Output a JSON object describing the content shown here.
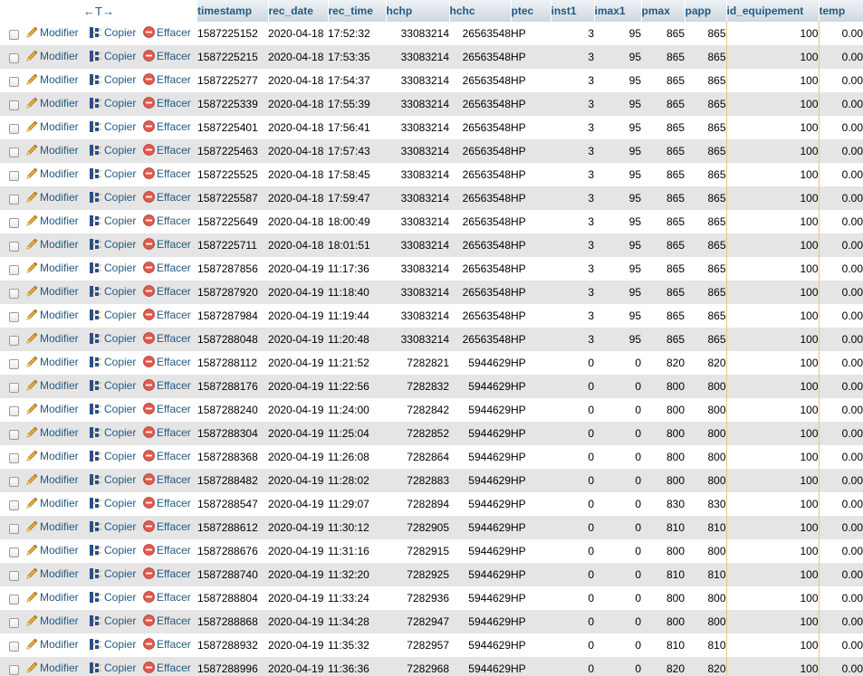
{
  "header": {
    "arrows_label": "←T→",
    "columns": [
      "timestamp",
      "rec_date",
      "rec_time",
      "hchp",
      "hchc",
      "ptec",
      "inst1",
      "imax1",
      "pmax",
      "papp",
      "id_equipement",
      "temp"
    ]
  },
  "actions": {
    "edit_label": "Modifier",
    "copy_label": "Copier",
    "delete_label": "Effacer",
    "edit_icon": "pencil-icon",
    "copy_icon": "copy-icon",
    "delete_icon": "delete-icon"
  },
  "colors": {
    "link": "#235a81",
    "row_alt": "#e5e5e5",
    "delete_icon": "#e05a4f"
  },
  "rows": [
    {
      "timestamp": "1587225152",
      "rec_date": "2020-04-18",
      "rec_time": "17:52:32",
      "hchp": "33083214",
      "hchc": "26563548",
      "ptec": "HP",
      "inst1": "3",
      "imax1": "95",
      "pmax": "865",
      "papp": "865",
      "id_equipement": "100",
      "temp": "0.00"
    },
    {
      "timestamp": "1587225215",
      "rec_date": "2020-04-18",
      "rec_time": "17:53:35",
      "hchp": "33083214",
      "hchc": "26563548",
      "ptec": "HP",
      "inst1": "3",
      "imax1": "95",
      "pmax": "865",
      "papp": "865",
      "id_equipement": "100",
      "temp": "0.00"
    },
    {
      "timestamp": "1587225277",
      "rec_date": "2020-04-18",
      "rec_time": "17:54:37",
      "hchp": "33083214",
      "hchc": "26563548",
      "ptec": "HP",
      "inst1": "3",
      "imax1": "95",
      "pmax": "865",
      "papp": "865",
      "id_equipement": "100",
      "temp": "0.00"
    },
    {
      "timestamp": "1587225339",
      "rec_date": "2020-04-18",
      "rec_time": "17:55:39",
      "hchp": "33083214",
      "hchc": "26563548",
      "ptec": "HP",
      "inst1": "3",
      "imax1": "95",
      "pmax": "865",
      "papp": "865",
      "id_equipement": "100",
      "temp": "0.00"
    },
    {
      "timestamp": "1587225401",
      "rec_date": "2020-04-18",
      "rec_time": "17:56:41",
      "hchp": "33083214",
      "hchc": "26563548",
      "ptec": "HP",
      "inst1": "3",
      "imax1": "95",
      "pmax": "865",
      "papp": "865",
      "id_equipement": "100",
      "temp": "0.00"
    },
    {
      "timestamp": "1587225463",
      "rec_date": "2020-04-18",
      "rec_time": "17:57:43",
      "hchp": "33083214",
      "hchc": "26563548",
      "ptec": "HP",
      "inst1": "3",
      "imax1": "95",
      "pmax": "865",
      "papp": "865",
      "id_equipement": "100",
      "temp": "0.00"
    },
    {
      "timestamp": "1587225525",
      "rec_date": "2020-04-18",
      "rec_time": "17:58:45",
      "hchp": "33083214",
      "hchc": "26563548",
      "ptec": "HP",
      "inst1": "3",
      "imax1": "95",
      "pmax": "865",
      "papp": "865",
      "id_equipement": "100",
      "temp": "0.00"
    },
    {
      "timestamp": "1587225587",
      "rec_date": "2020-04-18",
      "rec_time": "17:59:47",
      "hchp": "33083214",
      "hchc": "26563548",
      "ptec": "HP",
      "inst1": "3",
      "imax1": "95",
      "pmax": "865",
      "papp": "865",
      "id_equipement": "100",
      "temp": "0.00"
    },
    {
      "timestamp": "1587225649",
      "rec_date": "2020-04-18",
      "rec_time": "18:00:49",
      "hchp": "33083214",
      "hchc": "26563548",
      "ptec": "HP",
      "inst1": "3",
      "imax1": "95",
      "pmax": "865",
      "papp": "865",
      "id_equipement": "100",
      "temp": "0.00"
    },
    {
      "timestamp": "1587225711",
      "rec_date": "2020-04-18",
      "rec_time": "18:01:51",
      "hchp": "33083214",
      "hchc": "26563548",
      "ptec": "HP",
      "inst1": "3",
      "imax1": "95",
      "pmax": "865",
      "papp": "865",
      "id_equipement": "100",
      "temp": "0.00"
    },
    {
      "timestamp": "1587287856",
      "rec_date": "2020-04-19",
      "rec_time": "11:17:36",
      "hchp": "33083214",
      "hchc": "26563548",
      "ptec": "HP",
      "inst1": "3",
      "imax1": "95",
      "pmax": "865",
      "papp": "865",
      "id_equipement": "100",
      "temp": "0.00"
    },
    {
      "timestamp": "1587287920",
      "rec_date": "2020-04-19",
      "rec_time": "11:18:40",
      "hchp": "33083214",
      "hchc": "26563548",
      "ptec": "HP",
      "inst1": "3",
      "imax1": "95",
      "pmax": "865",
      "papp": "865",
      "id_equipement": "100",
      "temp": "0.00"
    },
    {
      "timestamp": "1587287984",
      "rec_date": "2020-04-19",
      "rec_time": "11:19:44",
      "hchp": "33083214",
      "hchc": "26563548",
      "ptec": "HP",
      "inst1": "3",
      "imax1": "95",
      "pmax": "865",
      "papp": "865",
      "id_equipement": "100",
      "temp": "0.00"
    },
    {
      "timestamp": "1587288048",
      "rec_date": "2020-04-19",
      "rec_time": "11:20:48",
      "hchp": "33083214",
      "hchc": "26563548",
      "ptec": "HP",
      "inst1": "3",
      "imax1": "95",
      "pmax": "865",
      "papp": "865",
      "id_equipement": "100",
      "temp": "0.00"
    },
    {
      "timestamp": "1587288112",
      "rec_date": "2020-04-19",
      "rec_time": "11:21:52",
      "hchp": "7282821",
      "hchc": "5944629",
      "ptec": "HP",
      "inst1": "0",
      "imax1": "0",
      "pmax": "820",
      "papp": "820",
      "id_equipement": "100",
      "temp": "0.00"
    },
    {
      "timestamp": "1587288176",
      "rec_date": "2020-04-19",
      "rec_time": "11:22:56",
      "hchp": "7282832",
      "hchc": "5944629",
      "ptec": "HP",
      "inst1": "0",
      "imax1": "0",
      "pmax": "800",
      "papp": "800",
      "id_equipement": "100",
      "temp": "0.00"
    },
    {
      "timestamp": "1587288240",
      "rec_date": "2020-04-19",
      "rec_time": "11:24:00",
      "hchp": "7282842",
      "hchc": "5944629",
      "ptec": "HP",
      "inst1": "0",
      "imax1": "0",
      "pmax": "800",
      "papp": "800",
      "id_equipement": "100",
      "temp": "0.00"
    },
    {
      "timestamp": "1587288304",
      "rec_date": "2020-04-19",
      "rec_time": "11:25:04",
      "hchp": "7282852",
      "hchc": "5944629",
      "ptec": "HP",
      "inst1": "0",
      "imax1": "0",
      "pmax": "800",
      "papp": "800",
      "id_equipement": "100",
      "temp": "0.00"
    },
    {
      "timestamp": "1587288368",
      "rec_date": "2020-04-19",
      "rec_time": "11:26:08",
      "hchp": "7282864",
      "hchc": "5944629",
      "ptec": "HP",
      "inst1": "0",
      "imax1": "0",
      "pmax": "800",
      "papp": "800",
      "id_equipement": "100",
      "temp": "0.00"
    },
    {
      "timestamp": "1587288482",
      "rec_date": "2020-04-19",
      "rec_time": "11:28:02",
      "hchp": "7282883",
      "hchc": "5944629",
      "ptec": "HP",
      "inst1": "0",
      "imax1": "0",
      "pmax": "800",
      "papp": "800",
      "id_equipement": "100",
      "temp": "0.00"
    },
    {
      "timestamp": "1587288547",
      "rec_date": "2020-04-19",
      "rec_time": "11:29:07",
      "hchp": "7282894",
      "hchc": "5944629",
      "ptec": "HP",
      "inst1": "0",
      "imax1": "0",
      "pmax": "830",
      "papp": "830",
      "id_equipement": "100",
      "temp": "0.00"
    },
    {
      "timestamp": "1587288612",
      "rec_date": "2020-04-19",
      "rec_time": "11:30:12",
      "hchp": "7282905",
      "hchc": "5944629",
      "ptec": "HP",
      "inst1": "0",
      "imax1": "0",
      "pmax": "810",
      "papp": "810",
      "id_equipement": "100",
      "temp": "0.00"
    },
    {
      "timestamp": "1587288676",
      "rec_date": "2020-04-19",
      "rec_time": "11:31:16",
      "hchp": "7282915",
      "hchc": "5944629",
      "ptec": "HP",
      "inst1": "0",
      "imax1": "0",
      "pmax": "800",
      "papp": "800",
      "id_equipement": "100",
      "temp": "0.00"
    },
    {
      "timestamp": "1587288740",
      "rec_date": "2020-04-19",
      "rec_time": "11:32:20",
      "hchp": "7282925",
      "hchc": "5944629",
      "ptec": "HP",
      "inst1": "0",
      "imax1": "0",
      "pmax": "810",
      "papp": "810",
      "id_equipement": "100",
      "temp": "0.00"
    },
    {
      "timestamp": "1587288804",
      "rec_date": "2020-04-19",
      "rec_time": "11:33:24",
      "hchp": "7282936",
      "hchc": "5944629",
      "ptec": "HP",
      "inst1": "0",
      "imax1": "0",
      "pmax": "800",
      "papp": "800",
      "id_equipement": "100",
      "temp": "0.00"
    },
    {
      "timestamp": "1587288868",
      "rec_date": "2020-04-19",
      "rec_time": "11:34:28",
      "hchp": "7282947",
      "hchc": "5944629",
      "ptec": "HP",
      "inst1": "0",
      "imax1": "0",
      "pmax": "800",
      "papp": "800",
      "id_equipement": "100",
      "temp": "0.00"
    },
    {
      "timestamp": "1587288932",
      "rec_date": "2020-04-19",
      "rec_time": "11:35:32",
      "hchp": "7282957",
      "hchc": "5944629",
      "ptec": "HP",
      "inst1": "0",
      "imax1": "0",
      "pmax": "810",
      "papp": "810",
      "id_equipement": "100",
      "temp": "0.00"
    },
    {
      "timestamp": "1587288996",
      "rec_date": "2020-04-19",
      "rec_time": "11:36:36",
      "hchp": "7282968",
      "hchc": "5944629",
      "ptec": "HP",
      "inst1": "0",
      "imax1": "0",
      "pmax": "820",
      "papp": "820",
      "id_equipement": "100",
      "temp": "0.00"
    }
  ]
}
